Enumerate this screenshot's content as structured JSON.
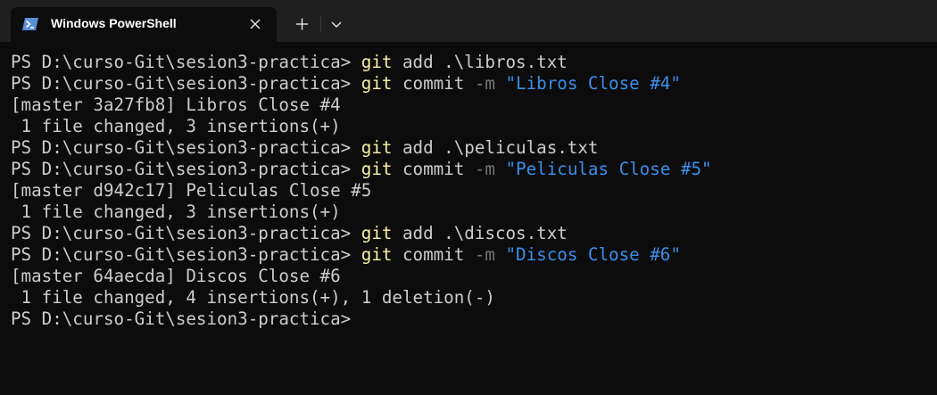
{
  "titlebar": {
    "tab_title": "Windows PowerShell",
    "tab_icon": "powershell-icon",
    "close_icon": "close-icon",
    "new_tab_icon": "plus-icon",
    "dropdown_icon": "chevron-down-icon"
  },
  "colors": {
    "background": "#0c0c0c",
    "titlebar": "#1f1f1f",
    "text": "#cccccc",
    "command": "#f9f1a5",
    "parameter": "#767676",
    "string": "#3b8eea"
  },
  "terminal": {
    "lines": [
      {
        "type": "cmd",
        "prompt": "PS D:\\curso-Git\\sesion3-practica> ",
        "cmd": "git",
        "args": " add .\\libros.txt",
        "flag": "",
        "string": ""
      },
      {
        "type": "cmd",
        "prompt": "PS D:\\curso-Git\\sesion3-practica> ",
        "cmd": "git",
        "args": " commit ",
        "flag": "-m",
        "string": " \"Libros Close #4\""
      },
      {
        "type": "out",
        "text": "[master 3a27fb8] Libros Close #4"
      },
      {
        "type": "out",
        "text": " 1 file changed, 3 insertions(+)"
      },
      {
        "type": "cmd",
        "prompt": "PS D:\\curso-Git\\sesion3-practica> ",
        "cmd": "git",
        "args": " add .\\peliculas.txt",
        "flag": "",
        "string": ""
      },
      {
        "type": "cmd",
        "prompt": "PS D:\\curso-Git\\sesion3-practica> ",
        "cmd": "git",
        "args": " commit ",
        "flag": "-m",
        "string": " \"Peliculas Close #5\""
      },
      {
        "type": "out",
        "text": "[master d942c17] Peliculas Close #5"
      },
      {
        "type": "out",
        "text": " 1 file changed, 3 insertions(+)"
      },
      {
        "type": "cmd",
        "prompt": "PS D:\\curso-Git\\sesion3-practica> ",
        "cmd": "git",
        "args": " add .\\discos.txt",
        "flag": "",
        "string": ""
      },
      {
        "type": "cmd",
        "prompt": "PS D:\\curso-Git\\sesion3-practica> ",
        "cmd": "git",
        "args": " commit ",
        "flag": "-m",
        "string": " \"Discos Close #6\""
      },
      {
        "type": "out",
        "text": "[master 64aecda] Discos Close #6"
      },
      {
        "type": "out",
        "text": " 1 file changed, 4 insertions(+), 1 deletion(-)"
      },
      {
        "type": "prompt",
        "prompt": "PS D:\\curso-Git\\sesion3-practica> "
      }
    ]
  }
}
